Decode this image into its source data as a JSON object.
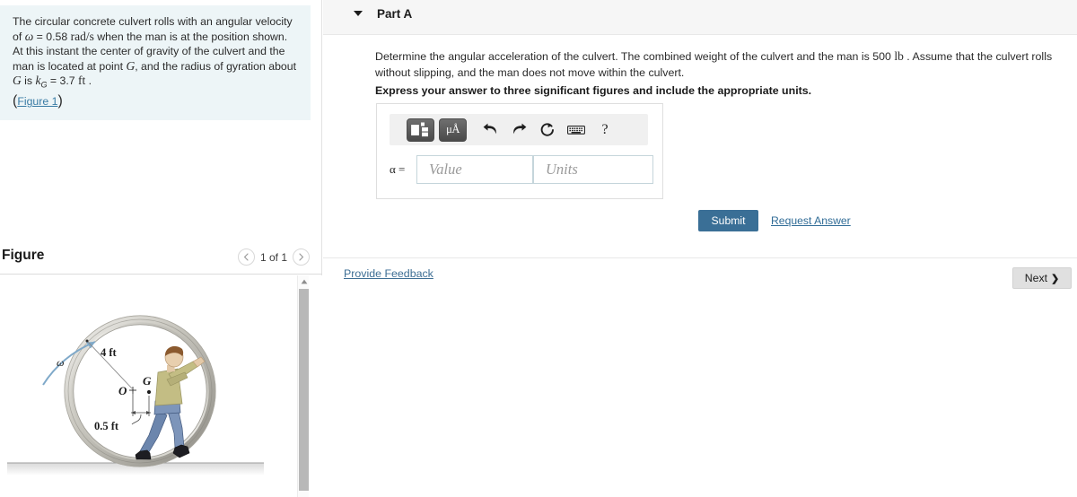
{
  "problem": {
    "text_part1": "The circular concrete culvert rolls with an angular velocity of ",
    "omega_symbol": "ω",
    "text_part2": " = 0.58 ",
    "omega_units": "rad/s",
    "text_part3": " when the man is at the position shown. At this instant the center of gravity of the culvert and the man is located at point ",
    "point_g": "G",
    "text_part4": ", and the radius of gyration about ",
    "point_g2": "G",
    "text_part5": " is ",
    "kg_symbol": "k",
    "kg_sub": "G",
    "text_part6": " = 3.7 ",
    "kg_units": "ft",
    "text_part7": " .",
    "figure_link": "Figure 1",
    "open_paren": "(",
    "close_paren": ")"
  },
  "figure": {
    "title": "Figure",
    "pager": {
      "prev_icon": "chevron-left",
      "count_label": "1 of 1",
      "next_icon": "chevron-right"
    },
    "scrollbar": {
      "up_arrow": "▲"
    },
    "labels": {
      "omega": "ω",
      "radius": "4 ft",
      "offset": "0.5 ft",
      "center_o": "O",
      "center_g": "G"
    }
  },
  "part": {
    "caret_icon": "caret-down",
    "title": "Part A",
    "question_part1": "Determine the angular acceleration of the culvert. The combined weight of the culvert and the man is 500 ",
    "question_units": "lb",
    "question_part2": " . Assume that the culvert rolls without slipping, and the man does not move within the culvert.",
    "instruction": "Express your answer to three significant figures and include the appropriate units."
  },
  "answer": {
    "toolbar": {
      "template_icon": "math-template-icon",
      "units_icon": "μÅ",
      "undo_icon": "undo-arrow-icon",
      "redo_icon": "redo-arrow-icon",
      "reset_icon": "reset-circle-icon",
      "keyboard_icon": "keyboard-icon",
      "help_icon": "?"
    },
    "variable_label": "α =",
    "value_placeholder": "Value",
    "units_placeholder": "Units"
  },
  "actions": {
    "submit_label": "Submit",
    "request_answer_label": "Request Answer",
    "provide_feedback_label": "Provide Feedback",
    "next_label": "Next",
    "next_chevron": "❯"
  },
  "colors": {
    "panel_bg": "#edf5f7",
    "submit_bg": "#3a6f96",
    "link": "#3a7ca5",
    "header_bg": "#f6f6f6"
  }
}
